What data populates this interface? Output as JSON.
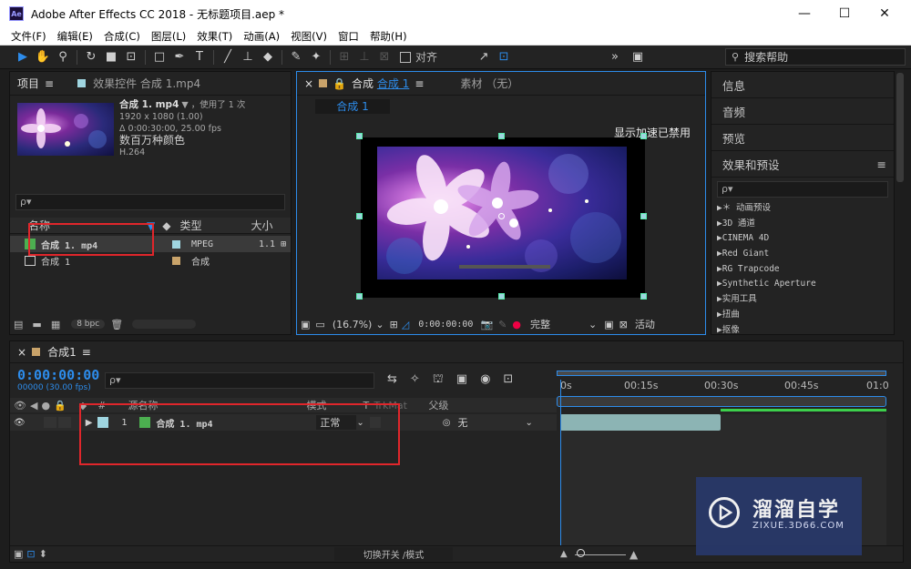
{
  "window": {
    "title": "Adobe After Effects CC 2018 - 无标题项目.aep *",
    "logo_text": "Ae",
    "minimize": "—",
    "maximize": "☐",
    "close": "✕"
  },
  "menu": [
    "文件(F)",
    "编辑(E)",
    "合成(C)",
    "图层(L)",
    "效果(T)",
    "动画(A)",
    "视图(V)",
    "窗口",
    "帮助(H)"
  ],
  "toolbar": {
    "align_label": "对齐",
    "search_placeholder": "搜索帮助",
    "expand": "»"
  },
  "project_panel": {
    "tab_project": "项目",
    "tab_effects": "效果控件 合成 1.mp4",
    "file_name": "合成 1. mp4",
    "usage": "，使用了 1 次",
    "resolution": "1920 x 1080 (1.00)",
    "duration": "Δ 0:00:30:00, 25.00 fps",
    "colors": "数百万种颜色",
    "codec": "H.264",
    "search_placeholder": "ρ▾",
    "columns": {
      "name": "名称",
      "type": "类型",
      "size": "大小"
    },
    "items": [
      {
        "name": "合成 1. mp4",
        "type": "MPEG",
        "size": "1.1",
        "label_color": "#9fd5e0"
      },
      {
        "name": "合成 1",
        "type": "合成",
        "size": "",
        "label_color": "#c9a36a"
      }
    ],
    "bpc": "8 bpc"
  },
  "comp_panel": {
    "tab_label": "合成",
    "tab_name": "合成 1",
    "footage_tab": "素材 （无）",
    "sub_tab": "合成 1",
    "note": "显示加速已禁用",
    "zoom": "(16.7%)",
    "timecode": "0:00:00:00",
    "quality": "完整",
    "view": "活动"
  },
  "right_panel": {
    "sections": [
      "信息",
      "音频",
      "预览",
      "效果和预设"
    ],
    "search_placeholder": "ρ▾",
    "effects": [
      "▶＊ 动画预设",
      "▶3D 通道",
      "▶CINEMA 4D",
      "▶Red Giant",
      "▶RG Trapcode",
      "▶Synthetic Aperture",
      "▶实用工具",
      "▶扭曲",
      "▶抠像"
    ]
  },
  "timeline": {
    "tab_name": "合成1",
    "timecode": "0:00:00:00",
    "fps": "00000 (30.00 fps)",
    "search_placeholder": "ρ▾",
    "header": {
      "num": "#",
      "source": "源名称",
      "mode": "模式",
      "t": "T",
      "trkmat": "TrkMat",
      "parent": "父级"
    },
    "layer": {
      "index": "1",
      "name": "合成 1. mp4",
      "mode": "正常",
      "parent": "无"
    },
    "ruler": [
      "0s",
      "00:15s",
      "00:30s",
      "00:45s",
      "01:0"
    ],
    "switch_label": "切换开关 /模式"
  },
  "watermark": {
    "cn": "溜溜自学",
    "en": "ZIXUE.3D66.COM"
  }
}
